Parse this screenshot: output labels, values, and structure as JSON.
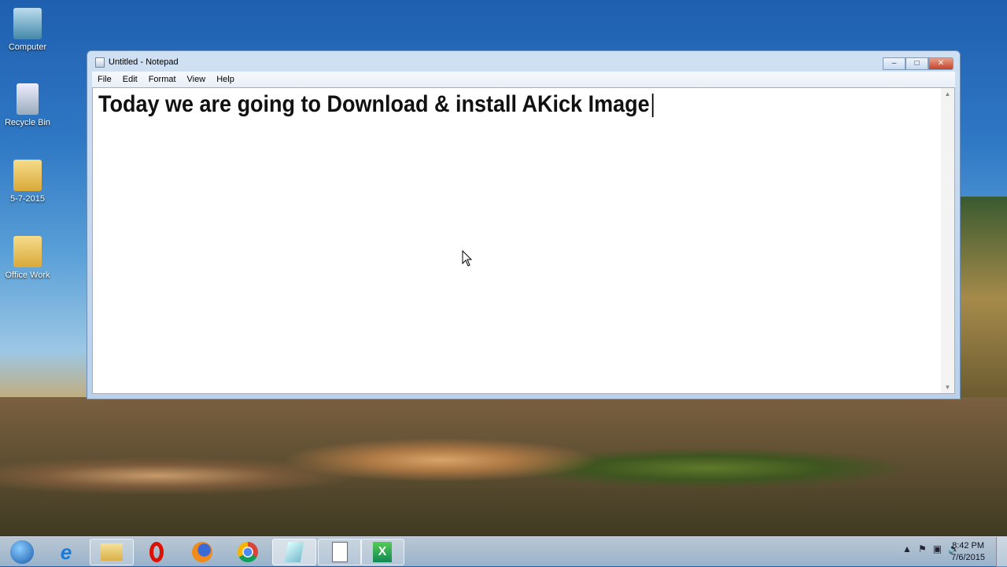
{
  "desktop": {
    "icons": [
      {
        "label": "Computer"
      },
      {
        "label": "Recycle Bin"
      },
      {
        "label": "5-7-2015"
      },
      {
        "label": "Office Work"
      }
    ]
  },
  "window": {
    "title": "Untitled - Notepad",
    "menu": [
      "File",
      "Edit",
      "Format",
      "View",
      "Help"
    ],
    "content": "Today we are going to Download & install AKick Image"
  },
  "taskbar": {
    "clock_time": "8:42 PM",
    "clock_date": "7/6/2015"
  }
}
